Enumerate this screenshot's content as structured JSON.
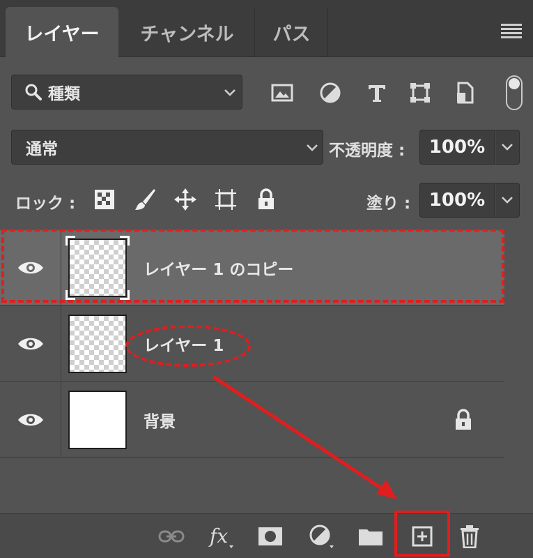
{
  "tabs": [
    {
      "label": "レイヤー",
      "active": true
    },
    {
      "label": "チャンネル",
      "active": false
    },
    {
      "label": "パス",
      "active": false
    }
  ],
  "filter": {
    "label": "種類",
    "icons": [
      "image-icon",
      "adjustment-icon",
      "type-icon",
      "shape-icon",
      "smart-object-icon"
    ]
  },
  "blend": {
    "mode": "通常",
    "opacity_label": "不透明度 :",
    "opacity_value": "100%"
  },
  "lock": {
    "label": "ロック :",
    "icons": [
      "lock-transparent-icon",
      "lock-image-icon",
      "lock-position-icon",
      "lock-artboard-icon",
      "lock-all-icon"
    ],
    "fill_label": "塗り :",
    "fill_value": "100%"
  },
  "layers": [
    {
      "name": "レイヤー 1 のコピー",
      "selected": true,
      "visible": true,
      "thumb": "transparent",
      "locked": false
    },
    {
      "name": "レイヤー 1",
      "selected": false,
      "visible": true,
      "thumb": "transparent",
      "locked": false
    },
    {
      "name": "背景",
      "selected": false,
      "visible": true,
      "thumb": "white",
      "locked": true
    }
  ],
  "bottom_tools": [
    "link-icon",
    "fx-icon",
    "mask-icon",
    "adjustment-layer-icon",
    "folder-icon",
    "new-layer-icon",
    "trash-icon"
  ],
  "colors": {
    "panel": "#535353",
    "selected_row": "#6a6a6a",
    "annotation": "#e01e1e"
  }
}
